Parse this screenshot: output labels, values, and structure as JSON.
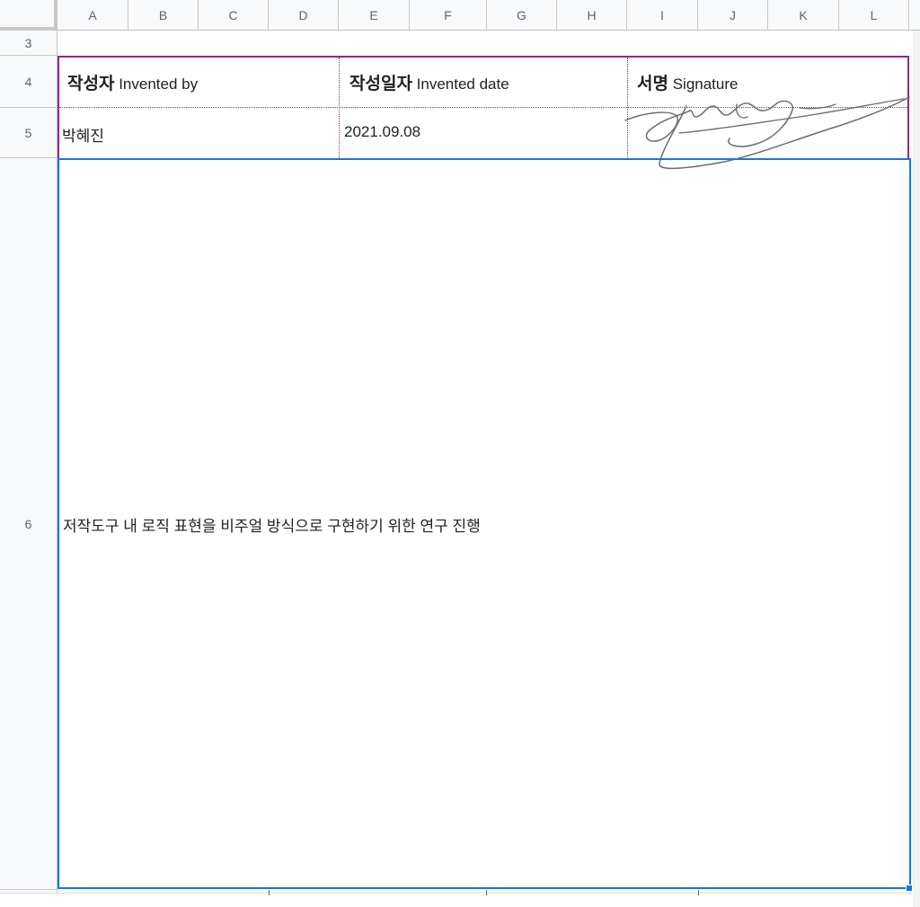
{
  "columns": [
    "A",
    "B",
    "C",
    "D",
    "E",
    "F",
    "G",
    "H",
    "I",
    "J",
    "K",
    "L"
  ],
  "rows": {
    "r3": "3",
    "r4": "4",
    "r5": "5",
    "r6": "6"
  },
  "form": {
    "author_label_ko": "작성자",
    "author_label_en": "Invented by",
    "date_label_ko": "작성일자",
    "date_label_en": "Invented date",
    "sign_label_ko": "서명",
    "sign_label_en": "Signature",
    "author_value": "박혜진",
    "date_value": "2021.09.08"
  },
  "body_text": "저작도구 내 로직 표현을 비주얼 방식으로 구현하기 위한 연구 진행",
  "colors": {
    "form_border": "#8e2d7a",
    "selection": "#1a73e8"
  }
}
